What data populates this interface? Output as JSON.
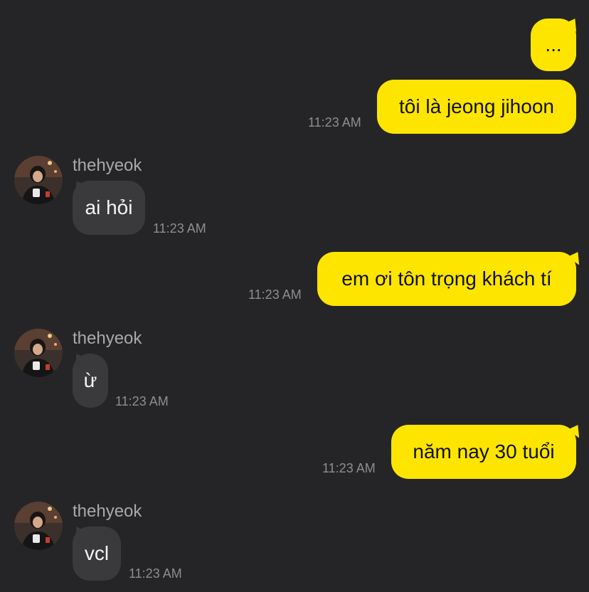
{
  "chat": {
    "contact_name": "thehyeok",
    "messages": [
      {
        "direction": "out",
        "text": "...",
        "time": ""
      },
      {
        "direction": "out",
        "text": "tôi là jeong jihoon",
        "time": "11:23 AM"
      },
      {
        "direction": "in",
        "sender": "thehyeok",
        "text": "ai hỏi",
        "time": "11:23 AM"
      },
      {
        "direction": "out",
        "text": "em ơi tôn trọng khách tí",
        "time": "11:23 AM"
      },
      {
        "direction": "in",
        "sender": "thehyeok",
        "text": "ừ",
        "time": "11:23 AM"
      },
      {
        "direction": "out",
        "text": "năm nay 30 tuổi",
        "time": "11:23 AM"
      },
      {
        "direction": "in",
        "sender": "thehyeok",
        "text": "vcl",
        "time": "11:23 AM"
      }
    ]
  },
  "colors": {
    "background": "#252527",
    "outgoing_bubble": "#FEE500",
    "incoming_bubble": "#3A3A3D",
    "timestamp": "#8E8E92"
  }
}
